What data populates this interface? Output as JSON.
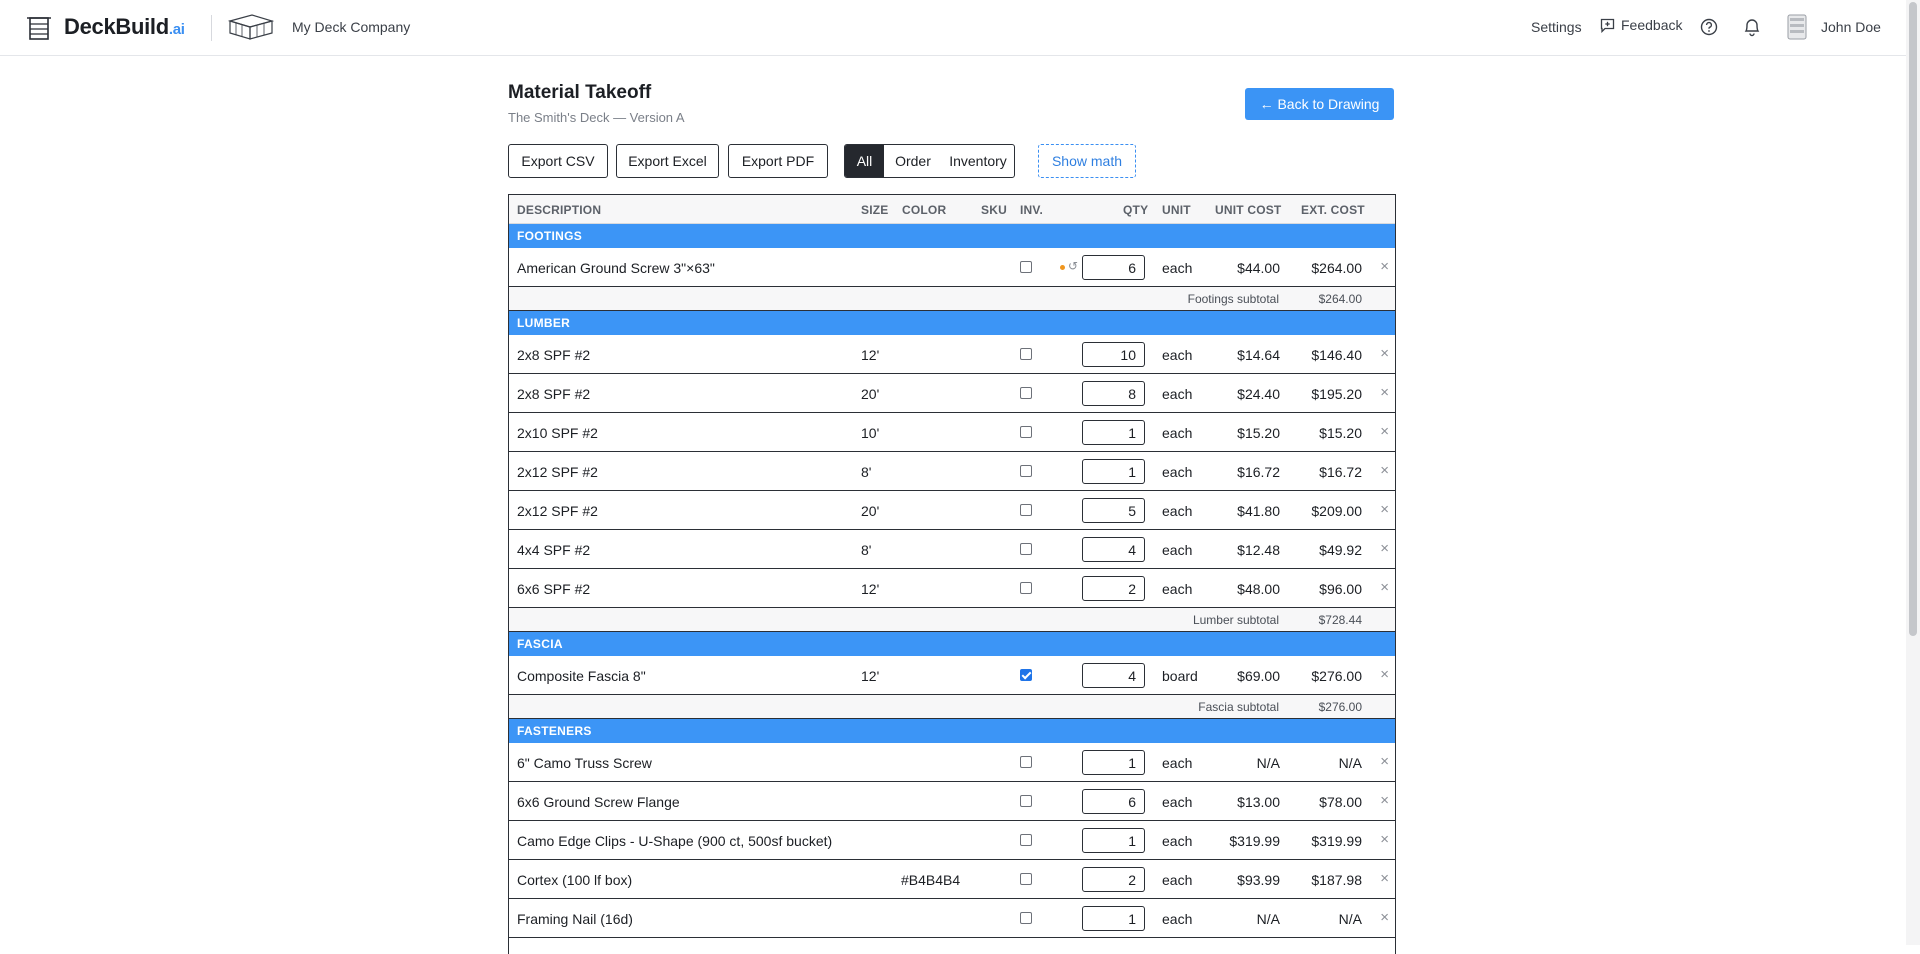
{
  "topbar": {
    "brand": "DeckBuild",
    "brand_suffix": ".ai",
    "company": "My Deck Company",
    "settings": "Settings",
    "feedback": "Feedback",
    "user": "John Doe"
  },
  "page": {
    "title": "Material Takeoff",
    "subtitle": "The Smith's Deck — Version A",
    "back": "← Back to Drawing"
  },
  "toolbar": {
    "export_csv": "Export CSV",
    "export_excel": "Export Excel",
    "export_pdf": "Export PDF",
    "filters": [
      "All",
      "Order",
      "Inventory"
    ],
    "active_filter": "All",
    "show_math": "Show math"
  },
  "table": {
    "headers": {
      "description": "DESCRIPTION",
      "size": "SIZE",
      "color": "COLOR",
      "sku": "SKU",
      "inv": "INV.",
      "qty": "QTY",
      "unit": "UNIT",
      "unit_cost": "UNIT COST",
      "ext_cost": "EXT. COST"
    },
    "sections": [
      {
        "name": "FOOTINGS",
        "items": [
          {
            "desc": "American Ground Screw 3\"×63\"",
            "size": "",
            "color": "",
            "inv": false,
            "qty": "6",
            "unit": "each",
            "unit_cost": "$44.00",
            "ext_cost": "$264.00",
            "modified": true
          }
        ],
        "subtotal_label": "Footings subtotal",
        "subtotal": "$264.00"
      },
      {
        "name": "LUMBER",
        "items": [
          {
            "desc": "2x8 SPF #2",
            "size": "12'",
            "color": "",
            "inv": false,
            "qty": "10",
            "unit": "each",
            "unit_cost": "$14.64",
            "ext_cost": "$146.40"
          },
          {
            "desc": "2x8 SPF #2",
            "size": "20'",
            "color": "",
            "inv": false,
            "qty": "8",
            "unit": "each",
            "unit_cost": "$24.40",
            "ext_cost": "$195.20"
          },
          {
            "desc": "2x10 SPF #2",
            "size": "10'",
            "color": "",
            "inv": false,
            "qty": "1",
            "unit": "each",
            "unit_cost": "$15.20",
            "ext_cost": "$15.20"
          },
          {
            "desc": "2x12 SPF #2",
            "size": "8'",
            "color": "",
            "inv": false,
            "qty": "1",
            "unit": "each",
            "unit_cost": "$16.72",
            "ext_cost": "$16.72"
          },
          {
            "desc": "2x12 SPF #2",
            "size": "20'",
            "color": "",
            "inv": false,
            "qty": "5",
            "unit": "each",
            "unit_cost": "$41.80",
            "ext_cost": "$209.00"
          },
          {
            "desc": "4x4 SPF #2",
            "size": "8'",
            "color": "",
            "inv": false,
            "qty": "4",
            "unit": "each",
            "unit_cost": "$12.48",
            "ext_cost": "$49.92"
          },
          {
            "desc": "6x6 SPF #2",
            "size": "12'",
            "color": "",
            "inv": false,
            "qty": "2",
            "unit": "each",
            "unit_cost": "$48.00",
            "ext_cost": "$96.00"
          }
        ],
        "subtotal_label": "Lumber subtotal",
        "subtotal": "$728.44"
      },
      {
        "name": "FASCIA",
        "items": [
          {
            "desc": "Composite Fascia 8\"",
            "size": "12'",
            "color": "",
            "inv": true,
            "qty": "4",
            "unit": "board",
            "unit_cost": "$69.00",
            "ext_cost": "$276.00"
          }
        ],
        "subtotal_label": "Fascia subtotal",
        "subtotal": "$276.00"
      },
      {
        "name": "FASTENERS",
        "items": [
          {
            "desc": "6\" Camo Truss Screw",
            "size": "",
            "color": "",
            "inv": false,
            "qty": "1",
            "unit": "each",
            "unit_cost": "N/A",
            "ext_cost": "N/A"
          },
          {
            "desc": "6x6 Ground Screw Flange",
            "size": "",
            "color": "",
            "inv": false,
            "qty": "6",
            "unit": "each",
            "unit_cost": "$13.00",
            "ext_cost": "$78.00"
          },
          {
            "desc": "Camo Edge Clips - U-Shape (900 ct, 500sf bucket)",
            "size": "",
            "color": "",
            "inv": false,
            "qty": "1",
            "unit": "each",
            "unit_cost": "$319.99",
            "ext_cost": "$319.99"
          },
          {
            "desc": "Cortex (100 lf box)",
            "size": "",
            "color": "#B4B4B4",
            "inv": false,
            "qty": "2",
            "unit": "each",
            "unit_cost": "$93.99",
            "ext_cost": "$187.98"
          },
          {
            "desc": "Framing Nail (16d)",
            "size": "",
            "color": "",
            "inv": false,
            "qty": "1",
            "unit": "each",
            "unit_cost": "N/A",
            "ext_cost": "N/A"
          }
        ]
      }
    ]
  },
  "colors": {
    "accent": "#3c95f6",
    "modified_dot": "#f0961e"
  }
}
